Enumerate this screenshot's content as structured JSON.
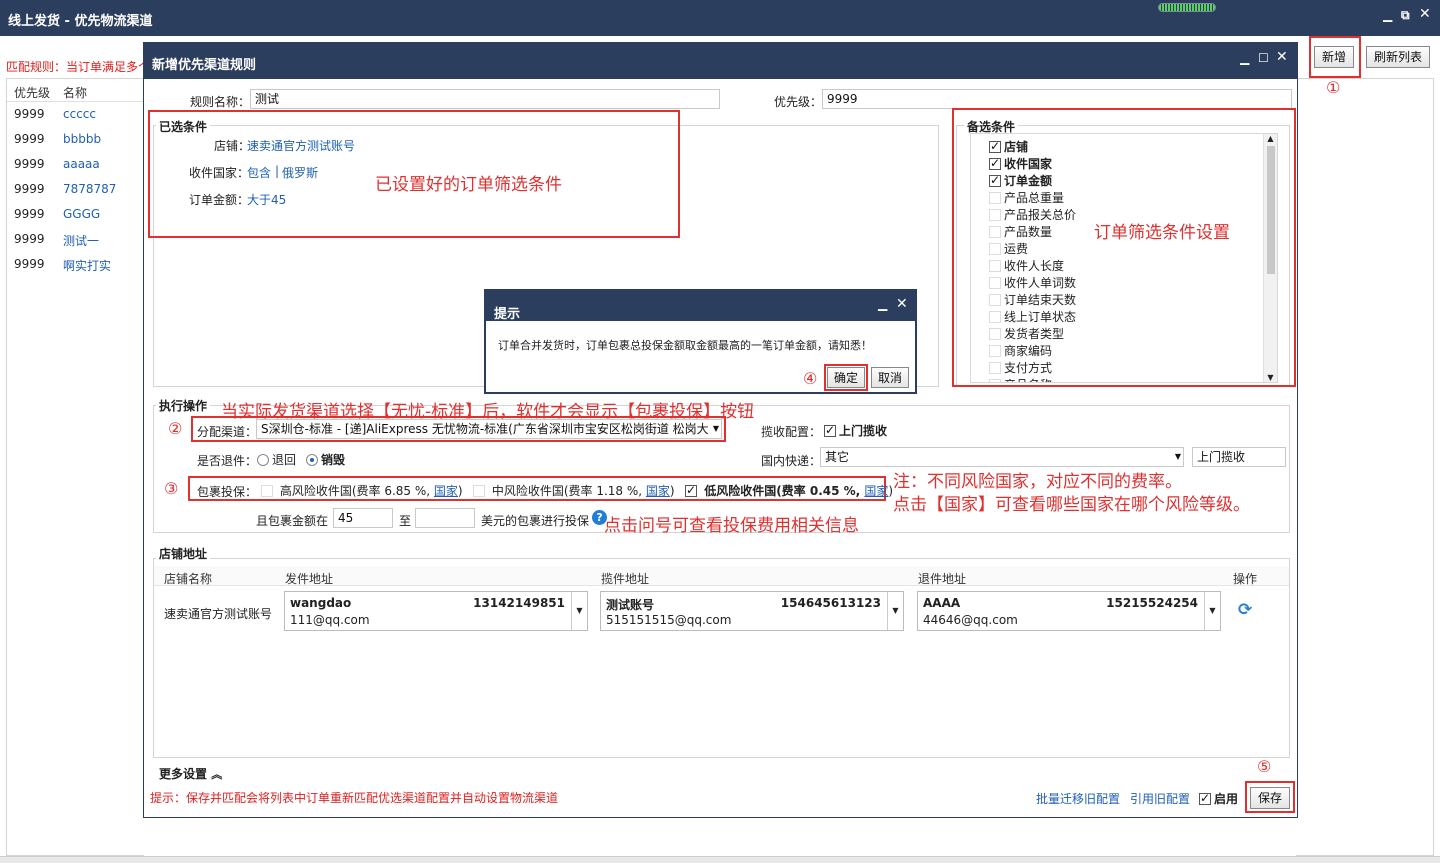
{
  "app": {
    "title": "线上发货 - 优先物流渠道",
    "window_controls": [
      "▁",
      "⧉",
      "✕"
    ]
  },
  "background": {
    "rule_notice": "匹配规则：当订单满足多个",
    "buttons": {
      "add": "新增",
      "refresh": "刷新列表"
    },
    "list_headers": [
      "优先级",
      "名称"
    ],
    "rows": [
      {
        "priority": "9999",
        "name": "ccccc"
      },
      {
        "priority": "9999",
        "name": "bbbbb"
      },
      {
        "priority": "9999",
        "name": "aaaaa"
      },
      {
        "priority": "9999",
        "name": "7878787"
      },
      {
        "priority": "9999",
        "name": "GGGG"
      },
      {
        "priority": "9999",
        "name": "测试一"
      },
      {
        "priority": "9999",
        "name": "啊实打实"
      }
    ]
  },
  "dialog": {
    "title": "新增优先渠道规则",
    "rule_name_label": "规则名称：",
    "rule_name_value": "测试",
    "priority_label": "优先级：",
    "priority_value": "9999",
    "selected": {
      "legend": "已选条件",
      "shop_label": "店铺：",
      "shop_value": "速卖通官方测试账号",
      "country_label": "收件国家：",
      "country_value1": "包含",
      "country_sep": "|",
      "country_value2": "俄罗斯",
      "amount_label": "订单金额：",
      "amount_value": "大于45"
    },
    "candidates": {
      "legend": "备选条件",
      "items": [
        {
          "label": "店铺",
          "checked": true
        },
        {
          "label": "收件国家",
          "checked": true
        },
        {
          "label": "订单金额",
          "checked": true
        },
        {
          "label": "产品总重量",
          "checked": false
        },
        {
          "label": "产品报关总价",
          "checked": false
        },
        {
          "label": "产品数量",
          "checked": false
        },
        {
          "label": "运费",
          "checked": false
        },
        {
          "label": "收件人长度",
          "checked": false
        },
        {
          "label": "收件人单词数",
          "checked": false
        },
        {
          "label": "订单结束天数",
          "checked": false
        },
        {
          "label": "线上订单状态",
          "checked": false
        },
        {
          "label": "发货者类型",
          "checked": false
        },
        {
          "label": "商家编码",
          "checked": false
        },
        {
          "label": "支付方式",
          "checked": false
        },
        {
          "label": "产品名称",
          "checked": false
        }
      ]
    },
    "action": {
      "legend": "执行操作",
      "channel_label": "分配渠道：",
      "channel_value": "S深圳仓-标准 - [递]AliExpress 无忧物流-标准(广东省深圳市宝安区松岗街道 松岗大",
      "pickup_label": "揽收配置：",
      "pickup_option": "上门揽收",
      "return_label": "是否退件：",
      "return_opt1": "退回",
      "return_opt2": "销毁",
      "domestic_label": "国内快递：",
      "domestic_value": "其它",
      "domestic_pickup": "上门揽收",
      "insure_label": "包裹投保：",
      "high_risk": "高风险收件国(费率 6.85 %,",
      "mid_risk": "中风险收件国(费率 1.18 %,",
      "low_risk": "低风险收件国(费率 0.45 %,",
      "country_link": "国家",
      "close_paren": ")",
      "amount_prefix": "且包裹金额在",
      "amount_from": "45",
      "amount_to_label": "至",
      "amount_to": "",
      "amount_suffix": "美元的包裹进行投保"
    },
    "address": {
      "legend": "店铺地址",
      "headers": [
        "店铺名称",
        "发件地址",
        "揽件地址",
        "退件地址",
        "操作"
      ],
      "shop": "速卖通官方测试账号",
      "sender": {
        "name": "wangdao",
        "phone": "13142149851",
        "email": "111@qq.com"
      },
      "pickup": {
        "name": "测试账号",
        "phone": "154645613123",
        "email": "515151515@qq.com"
      },
      "returns": {
        "name": "AAAA",
        "phone": "15215524254",
        "email": "44646@qq.com"
      }
    },
    "more_settings": "更多设置",
    "footer_tip": "提示：保存并匹配会将列表中订单重新匹配优选渠道配置并自动设置物流渠道",
    "batch_migrate": "批量迁移旧配置",
    "use_old": "引用旧配置",
    "enable": "启用",
    "save": "保存"
  },
  "prompt": {
    "title": "提示",
    "message": "订单合并发货时，订单包裹总投保金额取金额最高的一笔订单金额，请知悉！",
    "ok": "确定",
    "cancel": "取消"
  },
  "annotations": {
    "selected_note": "已设置好的订单筛选条件",
    "candidate_note": "订单筛选条件设置",
    "action_note": "当实际发货渠道选择【无忧-标准】后，软件才会显示【包裹投保】按钮",
    "risk_note1": "注：不同风险国家，对应不同的费率。",
    "risk_note2": "点击【国家】可查看哪些国家在哪个风险等级。",
    "help_note": "点击问号可查看投保费用相关信息",
    "n1": "①",
    "n2": "②",
    "n3": "③",
    "n4": "④",
    "n5": "⑤"
  }
}
